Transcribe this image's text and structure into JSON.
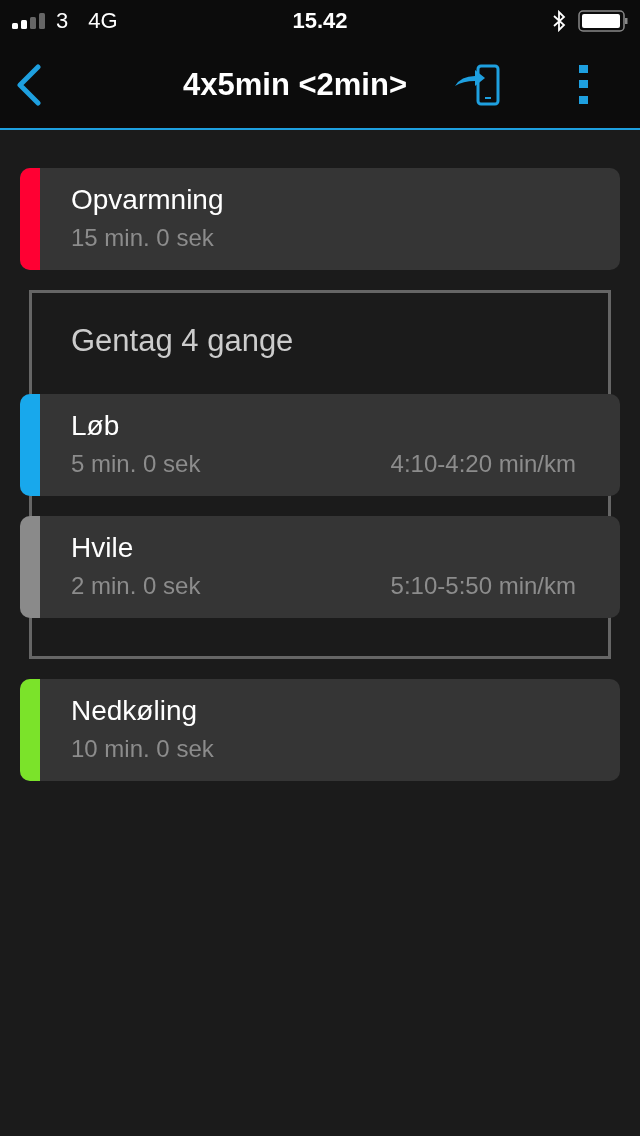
{
  "status_bar": {
    "carrier": "3",
    "network": "4G",
    "time": "15.42"
  },
  "nav": {
    "title": "4x5min <2min>"
  },
  "steps": [
    {
      "kind": "step",
      "name": "Opvarmning",
      "duration": "15 min. 0 sek",
      "color": "#ff0033"
    },
    {
      "kind": "repeat",
      "label": "Gentag 4 gange",
      "children": [
        {
          "kind": "step",
          "name": "Løb",
          "duration": "5 min. 0 sek",
          "target": "4:10-4:20 min/km",
          "color": "#18a8ec"
        },
        {
          "kind": "step",
          "name": "Hvile",
          "duration": "2 min. 0 sek",
          "target": "5:10-5:50 min/km",
          "color": "#8a8a8a"
        }
      ]
    },
    {
      "kind": "step",
      "name": "Nedkøling",
      "duration": "10 min. 0 sek",
      "color": "#7be32a"
    }
  ]
}
